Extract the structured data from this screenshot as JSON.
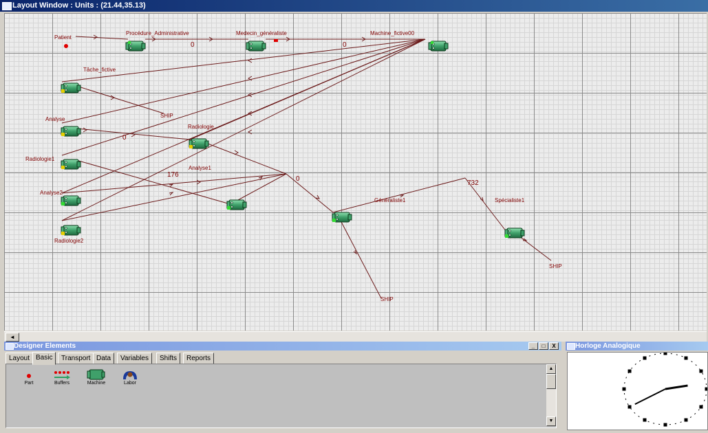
{
  "layout_window": {
    "title": "Layout Window : Units : (21.44,35.13)",
    "scroll_left_arrow": "◄",
    "labels": {
      "patient": "Patient",
      "proc_admin": "Procédure_Administrative",
      "medecin": "Medecin_généraliste",
      "machine_fictive": "Machine_fictive00",
      "tache_fictive": "Tâche_fictive",
      "ship1": "SHIP",
      "analyse": "Analyse",
      "radiologie": "Radiologie",
      "radiologie1": "Radiologie1",
      "analyse1": "Analyse1",
      "analyse2": "Analyse2",
      "radiologie2": "Radiologie2",
      "generaliste1": "Généraliste1",
      "specialiste1": "Spécialiste1",
      "ship2": "SHIP",
      "ship3": "SHIP",
      "count_0a": "0",
      "count_0b": "0",
      "count_0c": "0",
      "count_0d": "0",
      "count_176": "176",
      "count_732": "732"
    }
  },
  "designer": {
    "title": "Designer Elements",
    "win_buttons": {
      "minimize": "_",
      "maximize": "□",
      "close": "X"
    },
    "tabs": [
      "Layout",
      "Basic",
      "Transport",
      "Data",
      "Variables",
      "Shifts",
      "Reports"
    ],
    "active_tab": "Basic",
    "palette": [
      {
        "label": "Part",
        "icon": "part-icon"
      },
      {
        "label": "Buffers",
        "icon": "buffer-icon"
      },
      {
        "label": "Machine",
        "icon": "machine-icon"
      },
      {
        "label": "Labor",
        "icon": "labor-icon"
      }
    ],
    "scroll_up": "▲",
    "scroll_down": "▼"
  },
  "clock": {
    "title": "Horloge Analogique",
    "hour_hand_hour": 2,
    "minute_hand_minute": 40
  },
  "colors": {
    "title_bar": "#0a246a",
    "label_text": "#800000",
    "machine_green": "#3fa06a"
  }
}
